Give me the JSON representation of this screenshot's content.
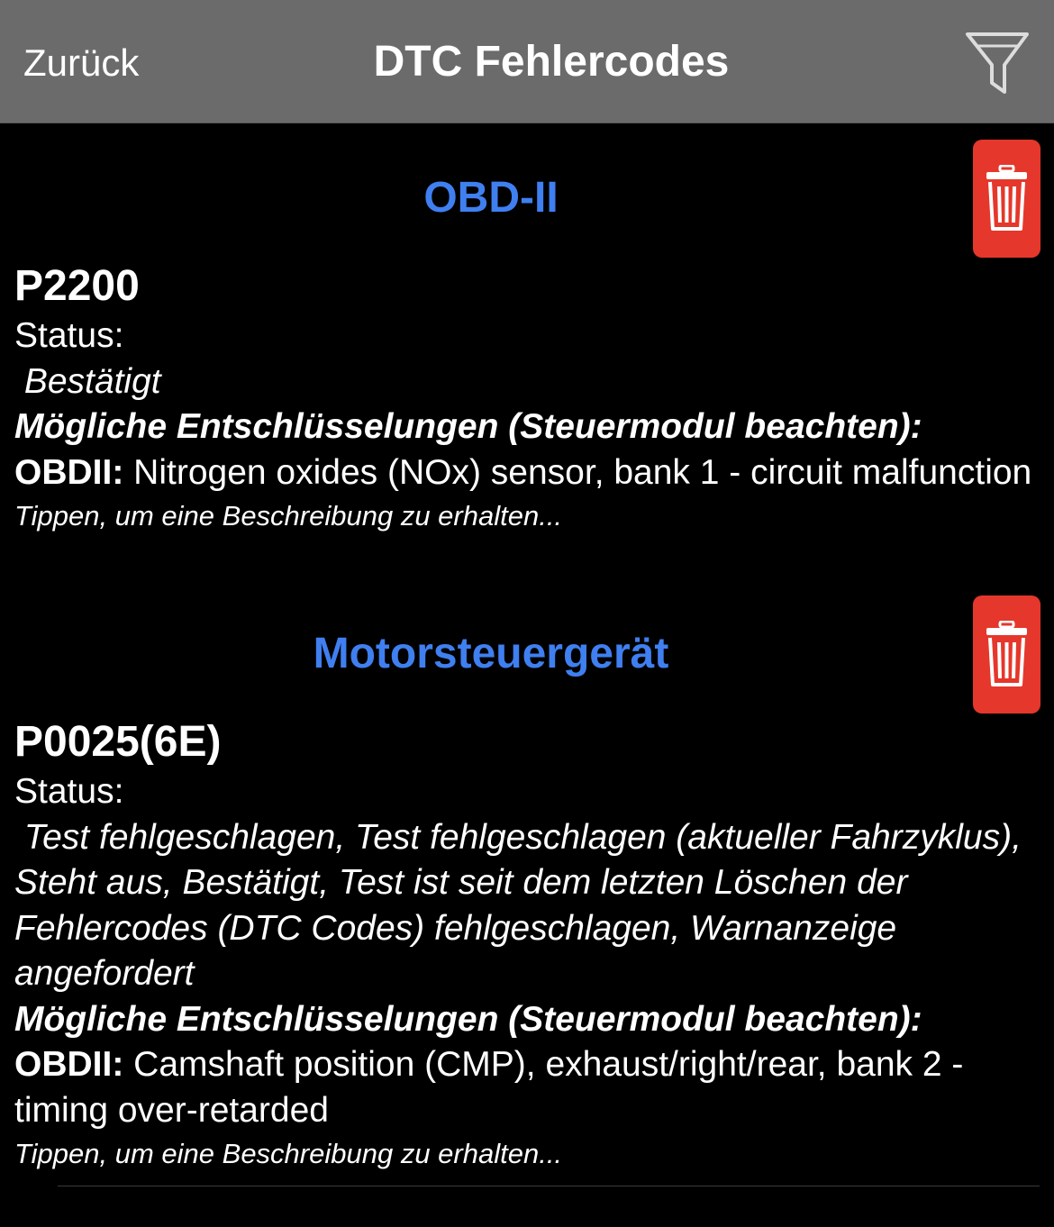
{
  "nav": {
    "back_label": "Zurück",
    "title": "DTC Fehlercodes",
    "filter_icon": "filter-icon"
  },
  "colors": {
    "navbar_bg": "#6b6b6b",
    "section_title": "#3f7ff0",
    "delete_button": "#e5372b",
    "background": "#000000"
  },
  "sections": [
    {
      "title": "OBD-II",
      "delete_icon": "trash-icon",
      "dtc": {
        "code": "P2200",
        "status_label": "Status:",
        "status_value": " Bestätigt",
        "decode_heading": "Mögliche Entschlüsselungen (Steuermodul beachten):",
        "decode_prefix": "OBDII:",
        "decode_text": " Nitrogen oxides (NOx) sensor, bank 1 - circuit malfunction",
        "hint": "Tippen, um eine Beschreibung zu erhalten..."
      }
    },
    {
      "title": "Motorsteuergerät",
      "delete_icon": "trash-icon",
      "dtc": {
        "code": "P0025(6E)",
        "status_label": "Status:",
        "status_value": " Test fehlgeschlagen, Test fehlgeschlagen (aktueller Fahrzyklus), Steht aus, Bestätigt, Test ist seit dem letzten Löschen der Fehlercodes (DTC Codes) fehlgeschlagen, Warnanzeige angefordert",
        "decode_heading": "Mögliche Entschlüsselungen (Steuermodul beachten):",
        "decode_prefix": "OBDII:",
        "decode_text": " Camshaft position (CMP), exhaust/right/rear, bank 2 - timing over-retarded",
        "hint": "Tippen, um eine Beschreibung zu erhalten..."
      }
    }
  ]
}
